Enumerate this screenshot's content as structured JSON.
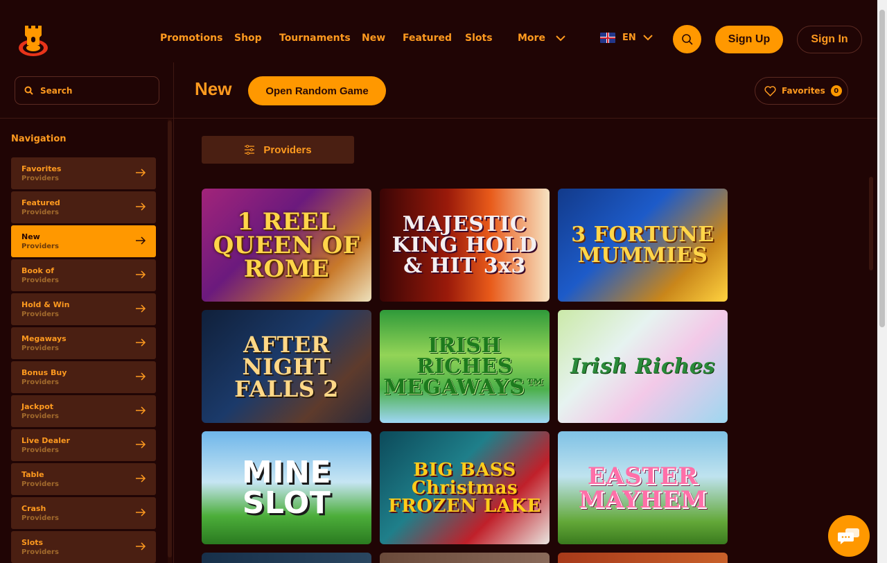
{
  "header": {
    "nav": [
      {
        "label": "Promotions"
      },
      {
        "label": "Shop"
      },
      {
        "label": "Tournaments"
      },
      {
        "label": "New"
      },
      {
        "label": "Featured"
      },
      {
        "label": "Slots"
      },
      {
        "label": "More"
      }
    ],
    "language": "EN",
    "signup_label": "Sign Up",
    "signin_label": "Sign In"
  },
  "sidebar": {
    "search_placeholder": "Search",
    "nav_title": "Navigation",
    "items": [
      {
        "label": "Favorites",
        "sub": "Providers"
      },
      {
        "label": "Featured",
        "sub": "Providers"
      },
      {
        "label": "New",
        "sub": "Providers",
        "active": true
      },
      {
        "label": "Book of",
        "sub": "Providers"
      },
      {
        "label": "Hold & Win",
        "sub": "Providers"
      },
      {
        "label": "Megaways",
        "sub": "Providers"
      },
      {
        "label": "Bonus Buy",
        "sub": "Providers"
      },
      {
        "label": "Jackpot",
        "sub": "Providers"
      },
      {
        "label": "Live Dealer",
        "sub": "Providers"
      },
      {
        "label": "Table",
        "sub": "Providers"
      },
      {
        "label": "Crash",
        "sub": "Providers"
      },
      {
        "label": "Slots",
        "sub": "Providers"
      }
    ]
  },
  "main": {
    "title": "New",
    "random_label": "Open Random Game",
    "favorites_label": "Favorites",
    "favorites_count": "0",
    "providers_label": "Providers",
    "games": [
      {
        "title": "1 REEL QUEEN OF ROME"
      },
      {
        "title": "MAJESTIC KING HOLD & HIT 3x3"
      },
      {
        "title": "3 FORTUNE MUMMIES"
      },
      {
        "title": "AFTER NIGHT FALLS 2"
      },
      {
        "title": "IRISH RICHES MEGAWAYS™"
      },
      {
        "title": "Irish Riches"
      },
      {
        "title": "MINE SLOT"
      },
      {
        "title": "BIG BASS Christmas FROZEN LAKE"
      },
      {
        "title": "EASTER MAYHEM"
      }
    ]
  },
  "colors": {
    "background": "#200505",
    "accent": "#ff9800",
    "panel": "#4a1f12",
    "text": "#ff9a1f"
  }
}
